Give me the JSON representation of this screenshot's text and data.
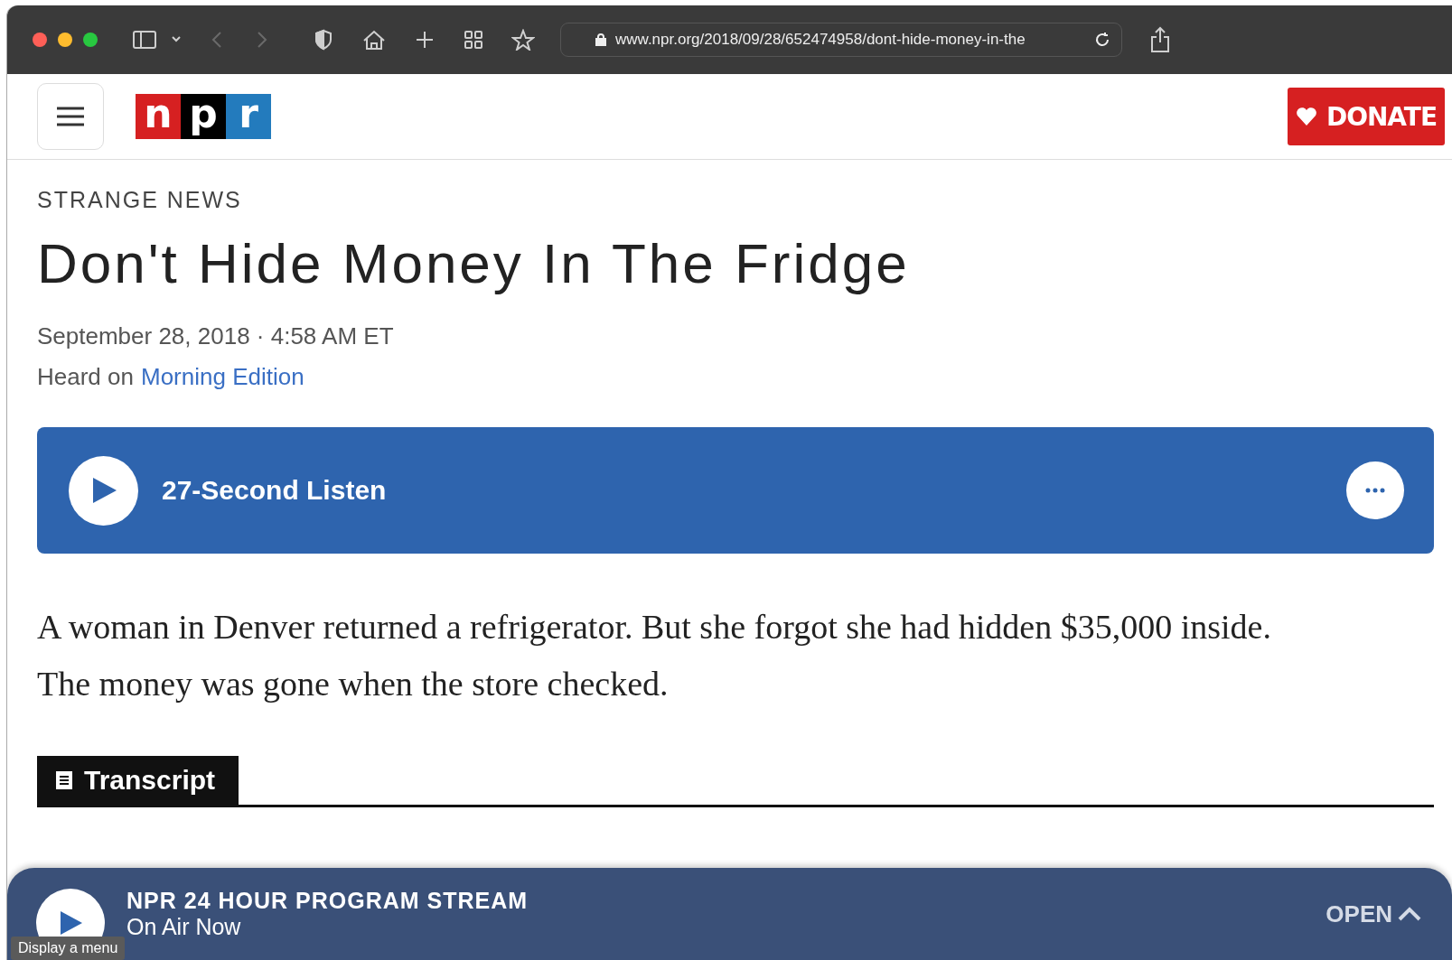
{
  "browser": {
    "url": "www.npr.org/2018/09/28/652474958/dont-hide-money-in-the"
  },
  "header": {
    "logo": [
      "n",
      "p",
      "r"
    ],
    "donate": "DONATE"
  },
  "article": {
    "category": "STRANGE NEWS",
    "title": "Don't Hide Money In The Fridge",
    "date": "September 28, 2018 · 4:58 AM ET",
    "heard_on": "Heard on",
    "program": "Morning Edition",
    "audio": {
      "label": "27-Second Listen"
    },
    "body": "A woman in Denver returned a refrigerator. But she forgot she had hidden $35,000 inside. The money was gone when the store checked.",
    "tabs": [
      {
        "label": "Transcript",
        "selected": true
      }
    ]
  },
  "player": {
    "title": "NPR 24 HOUR PROGRAM STREAM",
    "subtitle": "On Air Now",
    "open": "OPEN"
  },
  "tooltip": "Display a menu"
}
